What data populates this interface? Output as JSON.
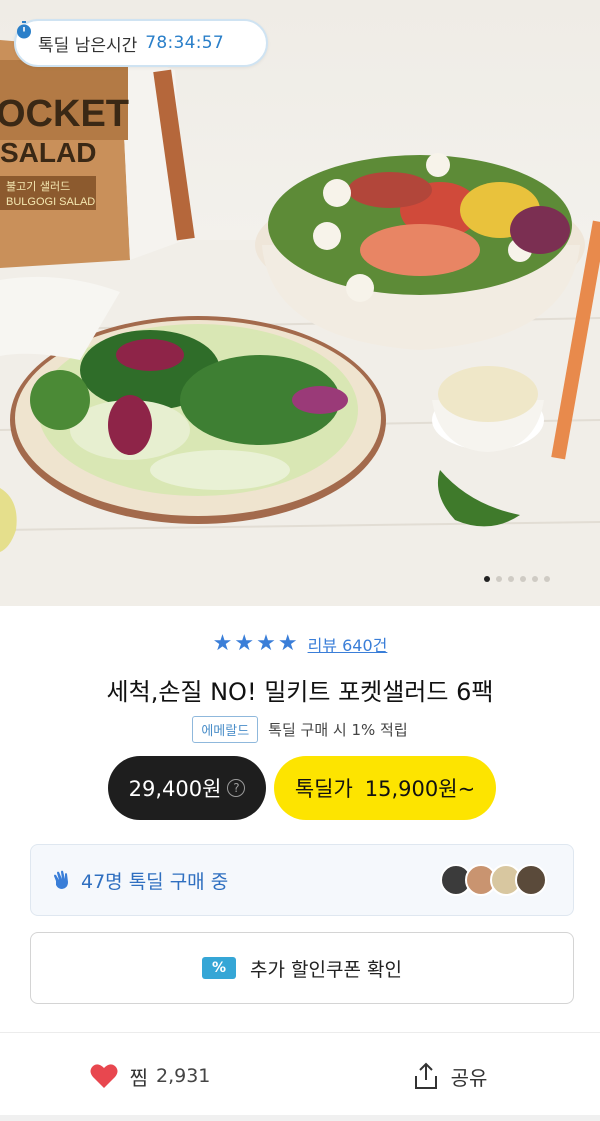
{
  "timer": {
    "label": "톡딜 남은시간",
    "value": "78:34:57"
  },
  "hero": {
    "package_brand": "POCKET SALAD",
    "package_name": "불고기 샐러드",
    "package_name_en": "BULGOGI SALAD",
    "slide_count": 6,
    "active_slide": 1
  },
  "product": {
    "rating_stars": 4,
    "review_label": "리뷰 640건",
    "title": "세척,손질 NO! 밀키트 포켓샐러드 6팩",
    "grade_badge": "에메랄드",
    "grade_text": "톡딜 구매 시 1% 적립"
  },
  "prices": {
    "normal": "29,400원",
    "deal_label": "톡딜가",
    "deal_price": "15,900원~"
  },
  "buyers": {
    "text": "47명 톡딜 구매 중"
  },
  "coupon": {
    "icon_text": "%",
    "label": "추가 할인쿠폰 확인"
  },
  "actions": {
    "wish_label": "찜",
    "wish_count": "2,931",
    "share_label": "공유"
  },
  "colors": {
    "accent_blue": "#3a7ed8",
    "deal_yellow": "#fde400",
    "dark_pill": "#1e1e1e",
    "heart_red": "#e8474f"
  }
}
